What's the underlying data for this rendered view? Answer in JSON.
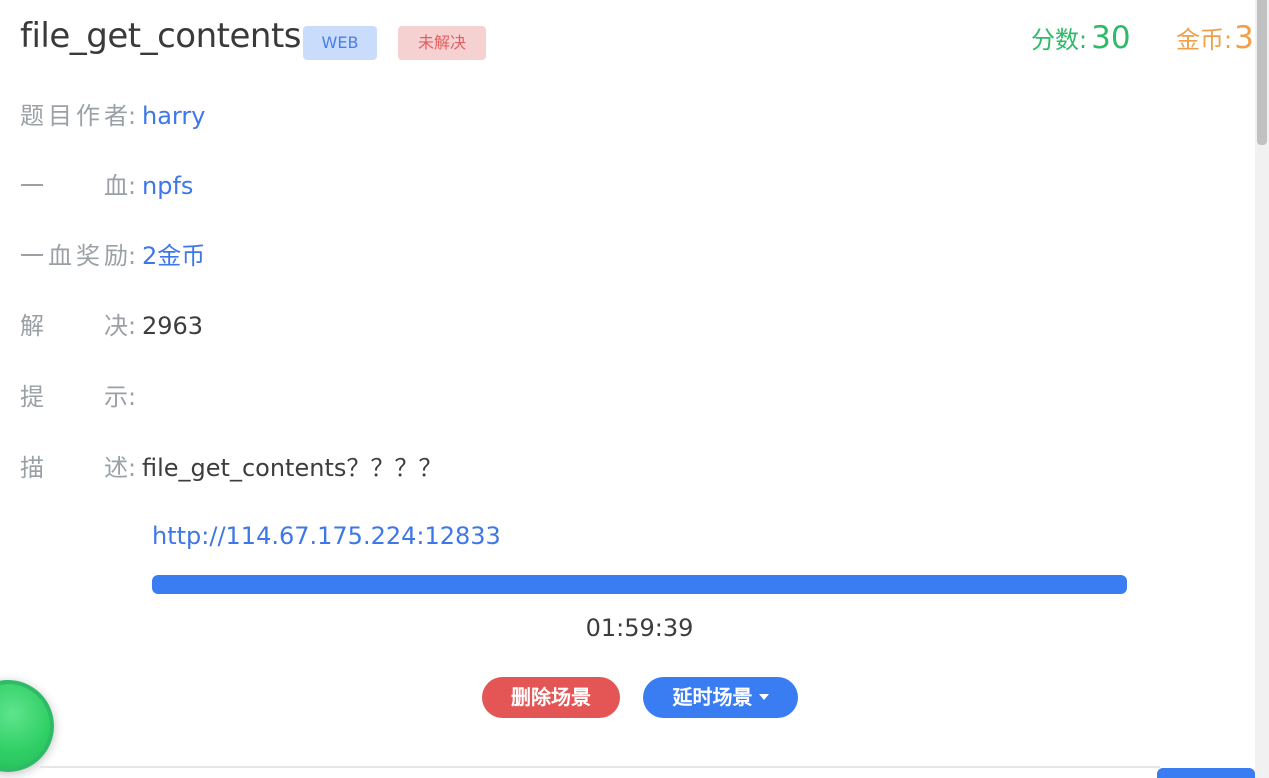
{
  "challenge": {
    "title": "file_get_contents",
    "category_badge": "WEB",
    "status_badge": "未解决"
  },
  "stats": {
    "score_label": "分数:",
    "score_value": "30",
    "coin_label": "金币:",
    "coin_value": "3"
  },
  "details": {
    "author_label": "题目作者",
    "author_value": "harry",
    "first_blood_label": "一血",
    "first_blood_value": "npfs",
    "first_blood_reward_label": "一血奖励",
    "first_blood_reward_value": "2金币",
    "solved_label": "解决",
    "solved_value": "2963",
    "hint_label": "提示",
    "hint_value": "",
    "description_label": "描述",
    "description_value": "file_get_contents？？？？",
    "colon": ":"
  },
  "scene": {
    "url": "http://114.67.175.224:12833",
    "progress_percent": 100,
    "remaining_time": "01:59:39",
    "delete_button": "删除场景",
    "extend_button": "延时场景"
  },
  "colors": {
    "accent_blue": "#3a7cf2",
    "success_green": "#2fba68",
    "coin_orange": "#f0a04b",
    "danger_red": "#e45656"
  }
}
